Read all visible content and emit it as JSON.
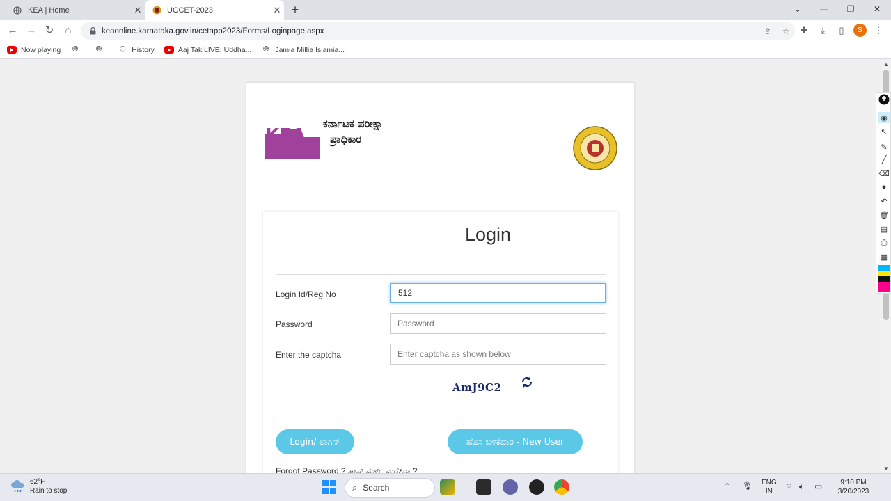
{
  "browser": {
    "tabs": [
      {
        "title": "KEA | Home",
        "active": false
      },
      {
        "title": "UGCET-2023",
        "active": true
      }
    ],
    "new_tab": "+",
    "url": "keaonline.karnataka.gov.in/cetapp2023/Forms/Loginpage.aspx",
    "profile_initial": "S",
    "bookmarks": [
      "Now playing",
      "History",
      "Aaj Tak LIVE: Uddha...",
      "Jamia Millia Islamia..."
    ]
  },
  "header": {
    "logo_letters": "KEA",
    "org_name_line1": "ಕರ್ನಾಟಕ ಪರೀಕ್ಷಾ",
    "org_name_line2": "ಪ್ರಾಧಿಕಾರ"
  },
  "login": {
    "title": "Login",
    "login_id_label": "Login Id/Reg No",
    "login_id_value": "512",
    "password_label": "Password",
    "password_placeholder": "Password",
    "captcha_label": "Enter the captcha",
    "captcha_placeholder": "Enter captcha as shown below",
    "captcha_text": "AmJ9C2",
    "login_button": "Login/ ಲಾಗಿನ್",
    "new_user_button": "ಹೊಸ ಬಳಕೆದಾರ - New User",
    "forgot_text": "Forgot Password ? ಪಾಸ್ ವರ್ಡ್ ಮರೆತಿರಾ ?"
  },
  "taskbar": {
    "temperature": "62°F",
    "weather": "Rain to stop",
    "search_label": "Search",
    "lang_line1": "ENG",
    "lang_line2": "IN",
    "time": "9:10 PM",
    "date": "3/20/2023"
  },
  "colors": {
    "kea_purple": "#a0429c",
    "button_blue": "#5bc8e8",
    "focus_border": "#66afe9"
  }
}
